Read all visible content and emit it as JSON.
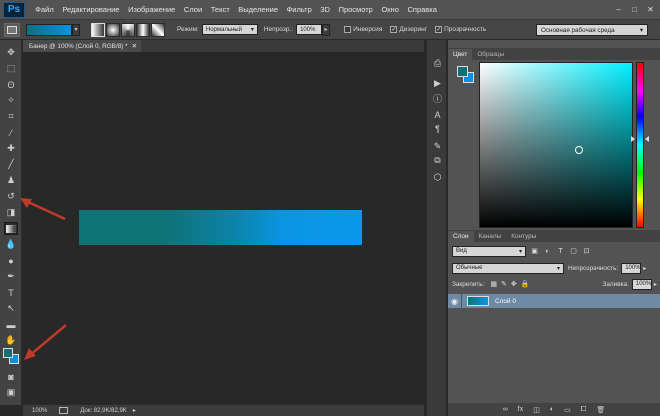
{
  "app": {
    "logo": "Ps"
  },
  "menu": [
    "Файл",
    "Редактирование",
    "Изображение",
    "Слои",
    "Текст",
    "Выделение",
    "Фильтр",
    "3D",
    "Просмотр",
    "Окно",
    "Справка"
  ],
  "window_controls": {
    "minimize": "–",
    "maximize": "□",
    "close": "✕"
  },
  "options": {
    "mode_label": "Режим:",
    "mode_value": "Нормальный",
    "opacity_label": "Непрозр.:",
    "opacity_value": "100%",
    "invert_label": "Инверсия",
    "dither_label": "Дизеринг",
    "transparency_label": "Прозрачность",
    "workspace_value": "Основная рабочая среда"
  },
  "document": {
    "tab_title": "Банер @ 100% (Слой 0, RGB/8) *",
    "tab_close": "✕",
    "zoom": "100%",
    "doc_size": "Док: 82,9K/82,9K"
  },
  "colors": {
    "foreground": "#117074",
    "background": "#0b8fdf",
    "arrow": "#c0392b"
  },
  "color_panel": {
    "tabs": [
      "Цвет",
      "Образцы"
    ]
  },
  "layers_panel": {
    "tabs": [
      "Слои",
      "Каналы",
      "Контуры"
    ],
    "filter_value": "Вид",
    "blend_mode": "Обычные",
    "opacity_label": "Непрозрачность:",
    "opacity_value": "100%",
    "lock_label": "Закрепить:",
    "fill_label": "Заливка:",
    "fill_value": "100%",
    "layer_name": "Слой 0"
  }
}
